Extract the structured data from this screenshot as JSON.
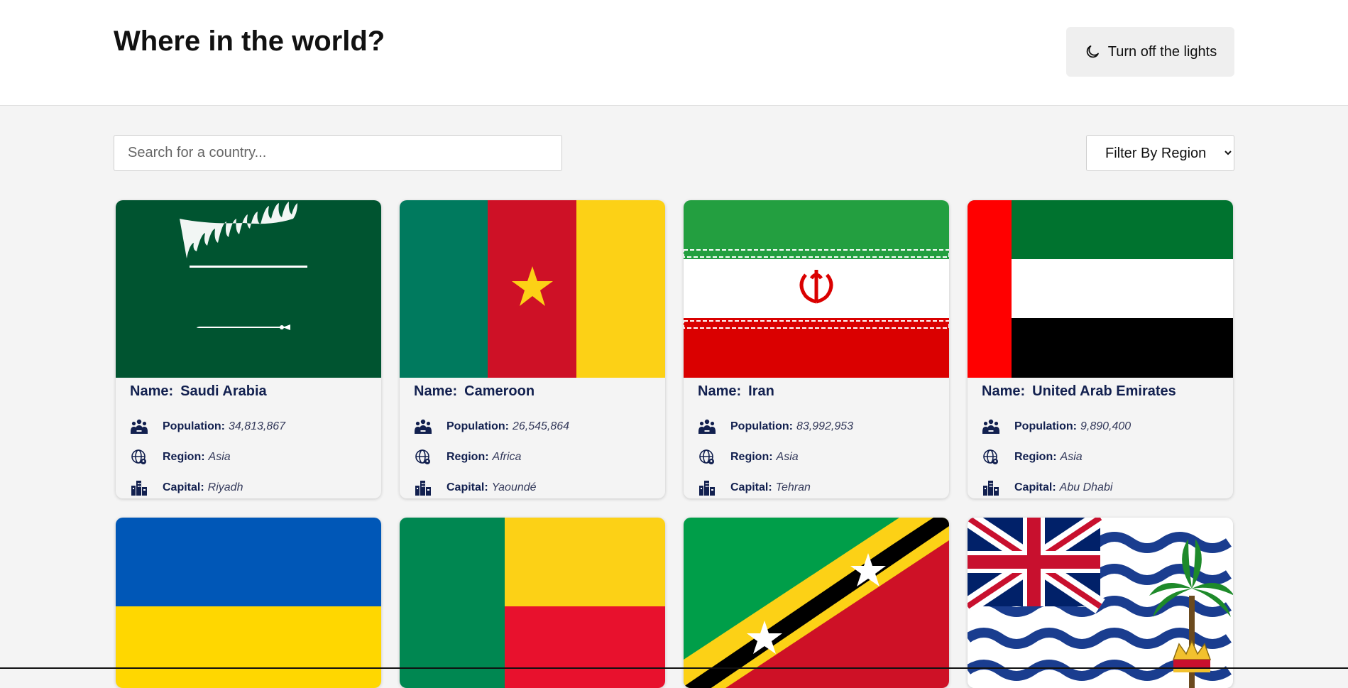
{
  "header": {
    "title": "Where in the world?",
    "theme_toggle_label": "Turn off the lights",
    "theme_toggle_icon": "moon-icon"
  },
  "controls": {
    "search_placeholder": "Search for a country...",
    "search_value": "",
    "region_filter_selected": "Filter By Region"
  },
  "labels": {
    "name": "Name:",
    "population": "Population:",
    "region": "Region:",
    "capital": "Capital:"
  },
  "countries": [
    {
      "name": "Saudi Arabia",
      "population": "34,813,867",
      "region": "Asia",
      "capital": "Riyadh"
    },
    {
      "name": "Cameroon",
      "population": "26,545,864",
      "region": "Africa",
      "capital": "Yaoundé"
    },
    {
      "name": "Iran",
      "population": "83,992,953",
      "region": "Asia",
      "capital": "Tehran"
    },
    {
      "name": "United Arab Emirates",
      "population": "9,890,400",
      "region": "Asia",
      "capital": "Abu Dhabi"
    }
  ],
  "colors": {
    "text_dark_blue": "#12204f",
    "background": "#f4f4f4",
    "header_bg": "#ffffff",
    "button_bg": "#efefef"
  }
}
